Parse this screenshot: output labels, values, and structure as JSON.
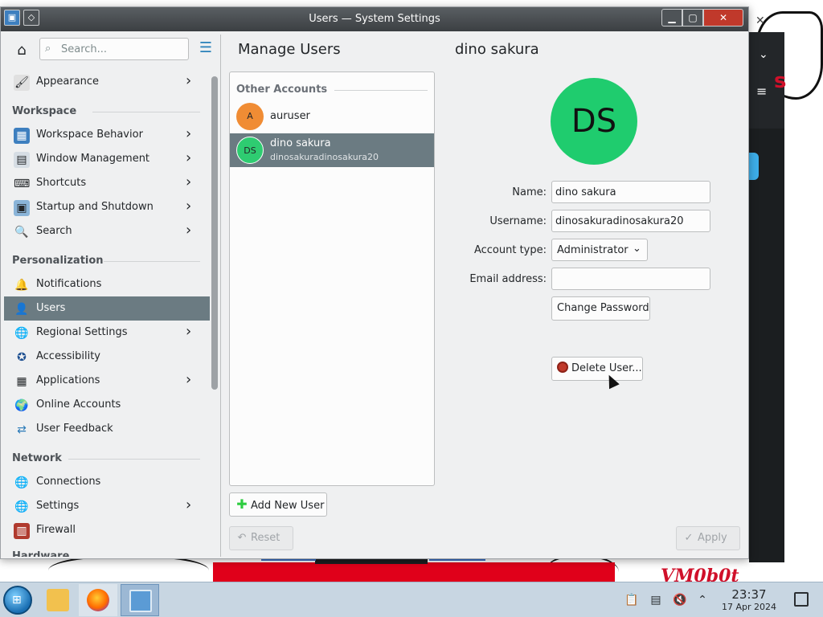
{
  "window": {
    "title": "Users — System Settings"
  },
  "sidebar": {
    "search_placeholder": "Search...",
    "items": [
      {
        "label": "Appearance",
        "icon": "appearance-icon"
      },
      {
        "section": "Workspace"
      },
      {
        "label": "Workspace Behavior",
        "icon": "workspace-behavior-icon"
      },
      {
        "label": "Window Management",
        "icon": "window-management-icon"
      },
      {
        "label": "Shortcuts",
        "icon": "shortcuts-icon"
      },
      {
        "label": "Startup and Shutdown",
        "icon": "startup-shutdown-icon"
      },
      {
        "label": "Search",
        "icon": "search-settings-icon"
      },
      {
        "section": "Personalization"
      },
      {
        "label": "Notifications",
        "icon": "notifications-icon"
      },
      {
        "label": "Users",
        "icon": "users-icon"
      },
      {
        "label": "Regional Settings",
        "icon": "regional-settings-icon"
      },
      {
        "label": "Accessibility",
        "icon": "accessibility-icon"
      },
      {
        "label": "Applications",
        "icon": "applications-icon"
      },
      {
        "label": "Online Accounts",
        "icon": "online-accounts-icon"
      },
      {
        "label": "User Feedback",
        "icon": "user-feedback-icon"
      },
      {
        "section": "Network"
      },
      {
        "label": "Connections",
        "icon": "connections-icon"
      },
      {
        "label": "Settings",
        "icon": "network-settings-icon"
      },
      {
        "label": "Firewall",
        "icon": "firewall-icon"
      },
      {
        "section": "Hardware"
      }
    ]
  },
  "header": {
    "page_title": "Manage Users",
    "user_title": "dino sakura"
  },
  "accounts": {
    "section_label": "Other Accounts",
    "list": [
      {
        "initials": "A",
        "name": "auruser",
        "username": ""
      },
      {
        "initials": "DS",
        "name": "dino sakura",
        "username": "dinosakuradinosakura20"
      }
    ],
    "add_button": "Add New User"
  },
  "user_details": {
    "avatar_initials": "DS",
    "avatar_color": "#1fcc6e",
    "name_label": "Name:",
    "name_value": "dino sakura",
    "username_label": "Username:",
    "username_value": "dinosakuradinosakura20",
    "account_type_label": "Account type:",
    "account_type_value": "Administrator",
    "email_label": "Email address:",
    "email_value": "",
    "change_password_button": "Change Password",
    "delete_user_button": "Delete User..."
  },
  "footer": {
    "reset_button": "Reset",
    "apply_button": "Apply"
  },
  "desktop": {
    "logo_text": "VM0b0t"
  },
  "taskbar": {
    "time": "23:37",
    "date": "17 Apr 2024"
  },
  "colors": {
    "selection": "#6b7b82",
    "accent": "#2980b9",
    "titlebar": "#3b3f42"
  }
}
